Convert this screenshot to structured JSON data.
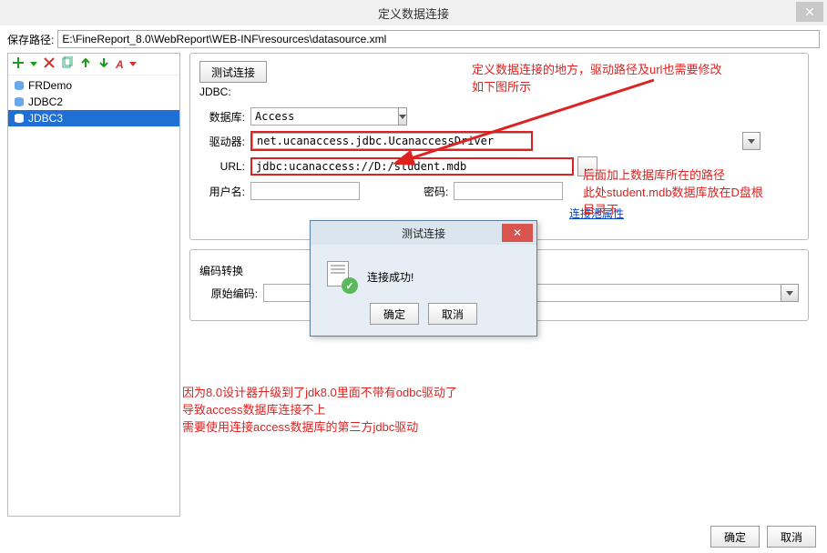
{
  "window": {
    "title": "定义数据连接"
  },
  "path": {
    "label": "保存路径:",
    "value": "E:\\FineReport_8.0\\WebReport\\WEB-INF\\resources\\datasource.xml"
  },
  "tree": {
    "items": [
      {
        "label": "FRDemo",
        "selected": false
      },
      {
        "label": "JDBC2",
        "selected": false
      },
      {
        "label": "JDBC3",
        "selected": true
      }
    ]
  },
  "panel": {
    "test_button": "测试连接",
    "section": "JDBC:",
    "db_label": "数据库:",
    "db_value": "Access",
    "driver_label": "驱动器:",
    "driver_value": "net.ucanaccess.jdbc.UcanaccessDriver",
    "url_label": "URL:",
    "url_value": "jdbc:ucanaccess://D:/student.mdb",
    "user_label": "用户名:",
    "user_value": "",
    "pass_label": "密码:",
    "pass_value": "",
    "pool_link": "连接池属性"
  },
  "panel2": {
    "encode_label": "编码转换",
    "orig_label": "原始编码:",
    "orig_value": ""
  },
  "popup": {
    "title": "测试连接",
    "msg": "连接成功!",
    "ok": "确定",
    "cancel": "取消"
  },
  "footer": {
    "ok": "确定",
    "cancel": "取消"
  },
  "annotations": {
    "top": "定义数据连接的地方，驱动路径及url也需要修改\n如下图所示",
    "right": "后面加上数据库所在的路径\n此处student.mdb数据库放在D盘根\n目录下",
    "bottom": "因为8.0设计器升级到了jdk8.0里面不带有odbc驱动了\n导致access数据库连接不上\n需要使用连接access数据库的第三方jdbc驱动"
  }
}
